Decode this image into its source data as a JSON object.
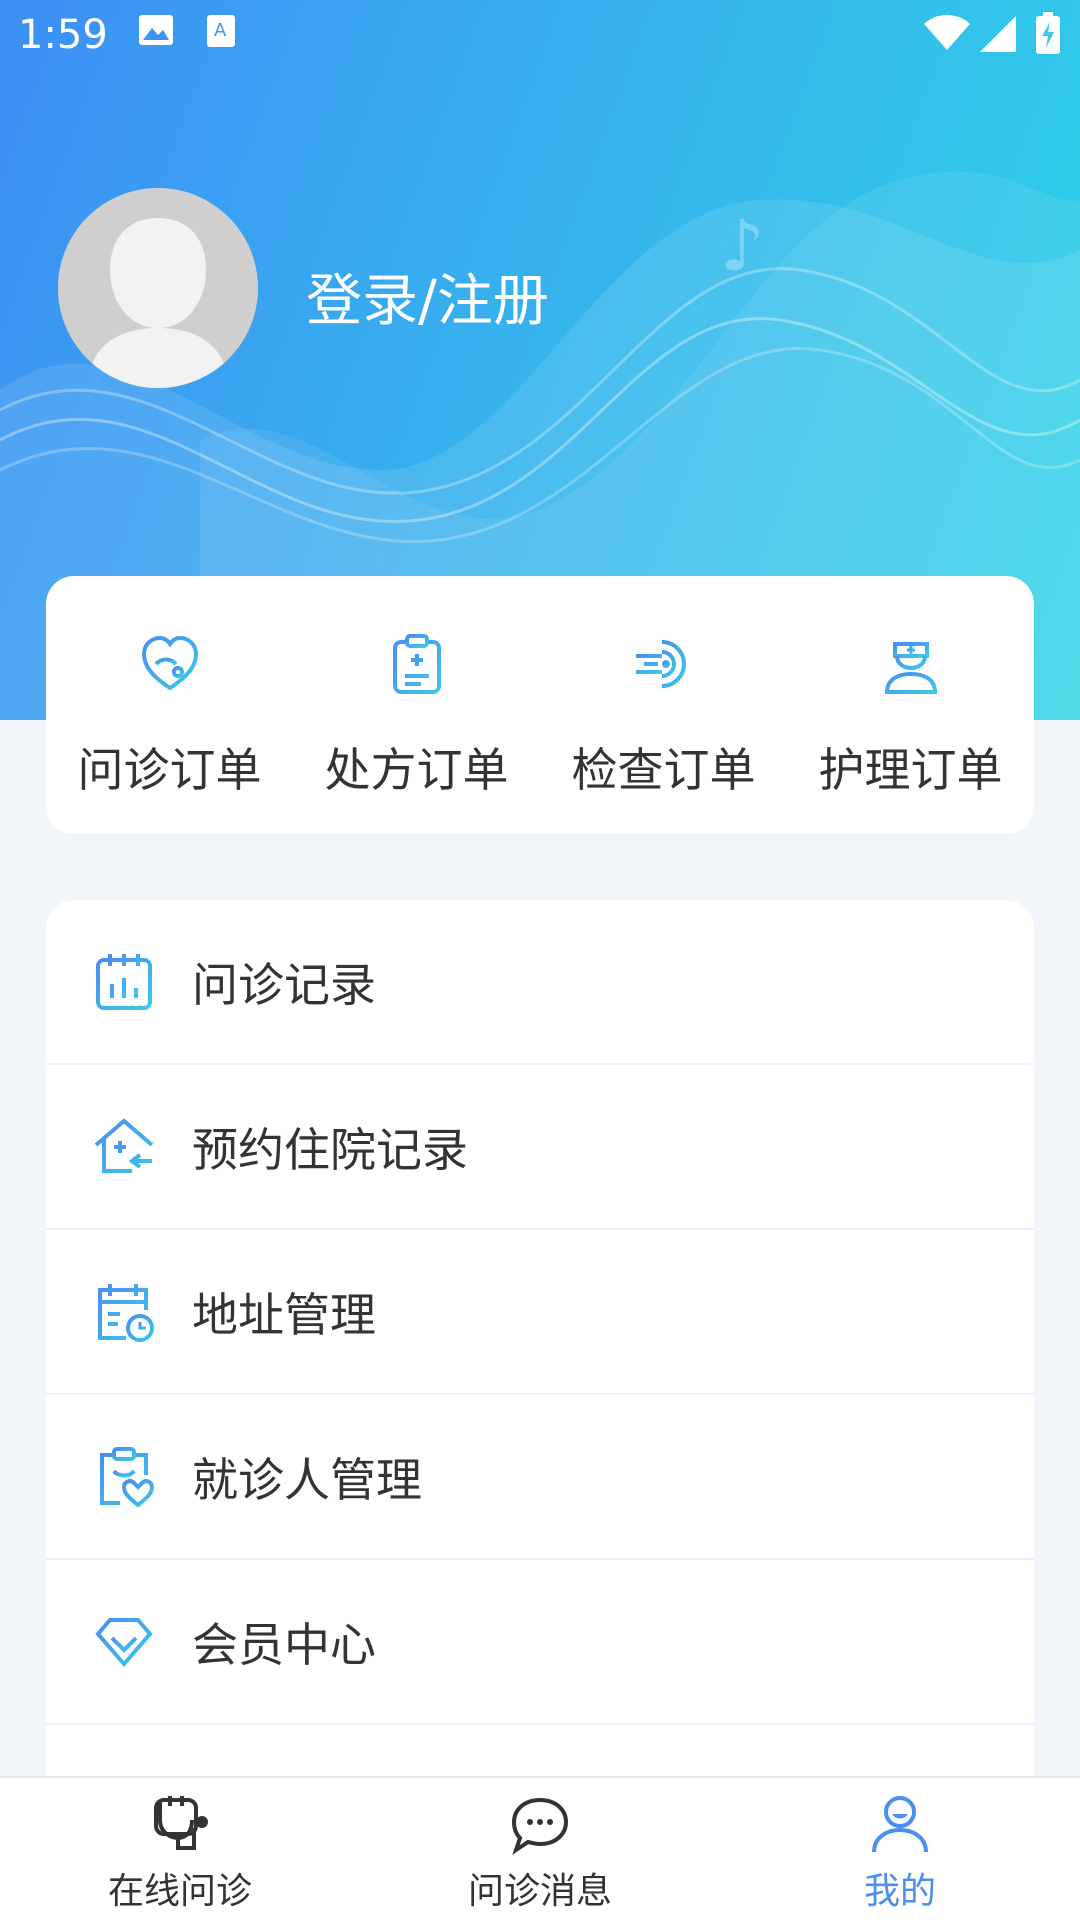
{
  "status_bar": {
    "time": "1:59",
    "icons": [
      "image-icon",
      "keyboard-a-icon",
      "wifi-icon",
      "signal-icon",
      "battery-charging-icon"
    ]
  },
  "profile": {
    "login_text": "登录/注册",
    "avatar_icon": "user-avatar-icon"
  },
  "orders": [
    {
      "label": "问诊订单",
      "icon": "heart-stethoscope-icon"
    },
    {
      "label": "处方订单",
      "icon": "clipboard-icon"
    },
    {
      "label": "检查订单",
      "icon": "scan-icon"
    },
    {
      "label": "护理订单",
      "icon": "nurse-icon"
    }
  ],
  "menu": [
    {
      "label": "问诊记录",
      "icon": "calendar-chart-icon"
    },
    {
      "label": "预约住院记录",
      "icon": "hospital-home-icon"
    },
    {
      "label": "地址管理",
      "icon": "calendar-clock-icon"
    },
    {
      "label": "就诊人管理",
      "icon": "clipboard-heart-icon"
    },
    {
      "label": "会员中心",
      "icon": "diamond-icon"
    }
  ],
  "bottom_nav": [
    {
      "label": "在线问诊",
      "icon": "stethoscope-icon",
      "active": false
    },
    {
      "label": "问诊消息",
      "icon": "chat-bubble-icon",
      "active": false
    },
    {
      "label": "我的",
      "icon": "person-icon",
      "active": true
    }
  ],
  "colors": {
    "accent": "#4a8ef0",
    "header_start": "#3d8ff5",
    "header_end": "#2bd3e6",
    "icon_blue": "#3aa6ec"
  }
}
